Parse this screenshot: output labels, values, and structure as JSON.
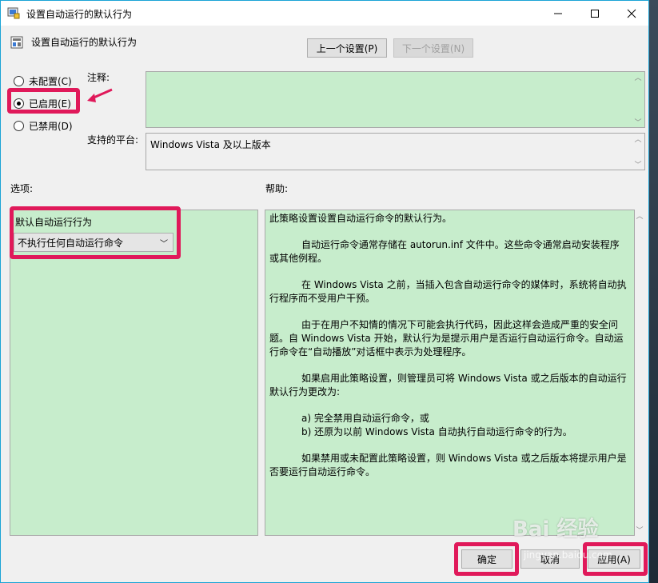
{
  "window": {
    "title": "设置自动运行的默认行为",
    "subtitle": "设置自动运行的默认行为"
  },
  "nav": {
    "prev_label": "上一个设置(P)",
    "next_label": "下一个设置(N)"
  },
  "state": {
    "not_configured": "未配置(C)",
    "enabled": "已启用(E)",
    "disabled": "已禁用(D)",
    "selected": "enabled"
  },
  "comment": {
    "label": "注释:",
    "value": ""
  },
  "platform": {
    "label": "支持的平台:",
    "value": "Windows Vista 及以上版本"
  },
  "options": {
    "header": "选项:",
    "field_label": "默认自动运行行为",
    "selected_value": "不执行任何自动运行命令"
  },
  "help": {
    "header": "帮助:",
    "paragraphs": [
      "此策略设置设置自动运行命令的默认行为。",
      "自动运行命令通常存储在 autorun.inf 文件中。这些命令通常启动安装程序或其他例程。",
      "在 Windows Vista 之前，当插入包含自动运行命令的媒体时，系统将自动执行程序而不受用户干预。",
      "由于在用户不知情的情况下可能会执行代码，因此这样会造成严重的安全问题。自 Windows Vista 开始，默认行为是提示用户是否运行自动运行命令。自动运行命令在“自动播放”对话框中表示为处理程序。",
      "如果启用此策略设置，则管理员可将 Windows Vista 或之后版本的自动运行默认行为更改为:",
      "a) 完全禁用自动运行命令，或",
      "b) 还原为以前 Windows Vista 自动执行自动运行命令的行为。",
      "如果禁用或未配置此策略设置，则 Windows Vista 或之后版本将提示用户是否要运行自动运行命令。"
    ]
  },
  "footer": {
    "ok_label": "确定",
    "cancel_label": "取消",
    "apply_label": "应用(A)"
  },
  "watermark": {
    "brand": "Bai 经验",
    "sub": "jingyan.baidu.com"
  },
  "colors": {
    "highlight": "#e0195a",
    "panel_green": "#c7edcc"
  }
}
